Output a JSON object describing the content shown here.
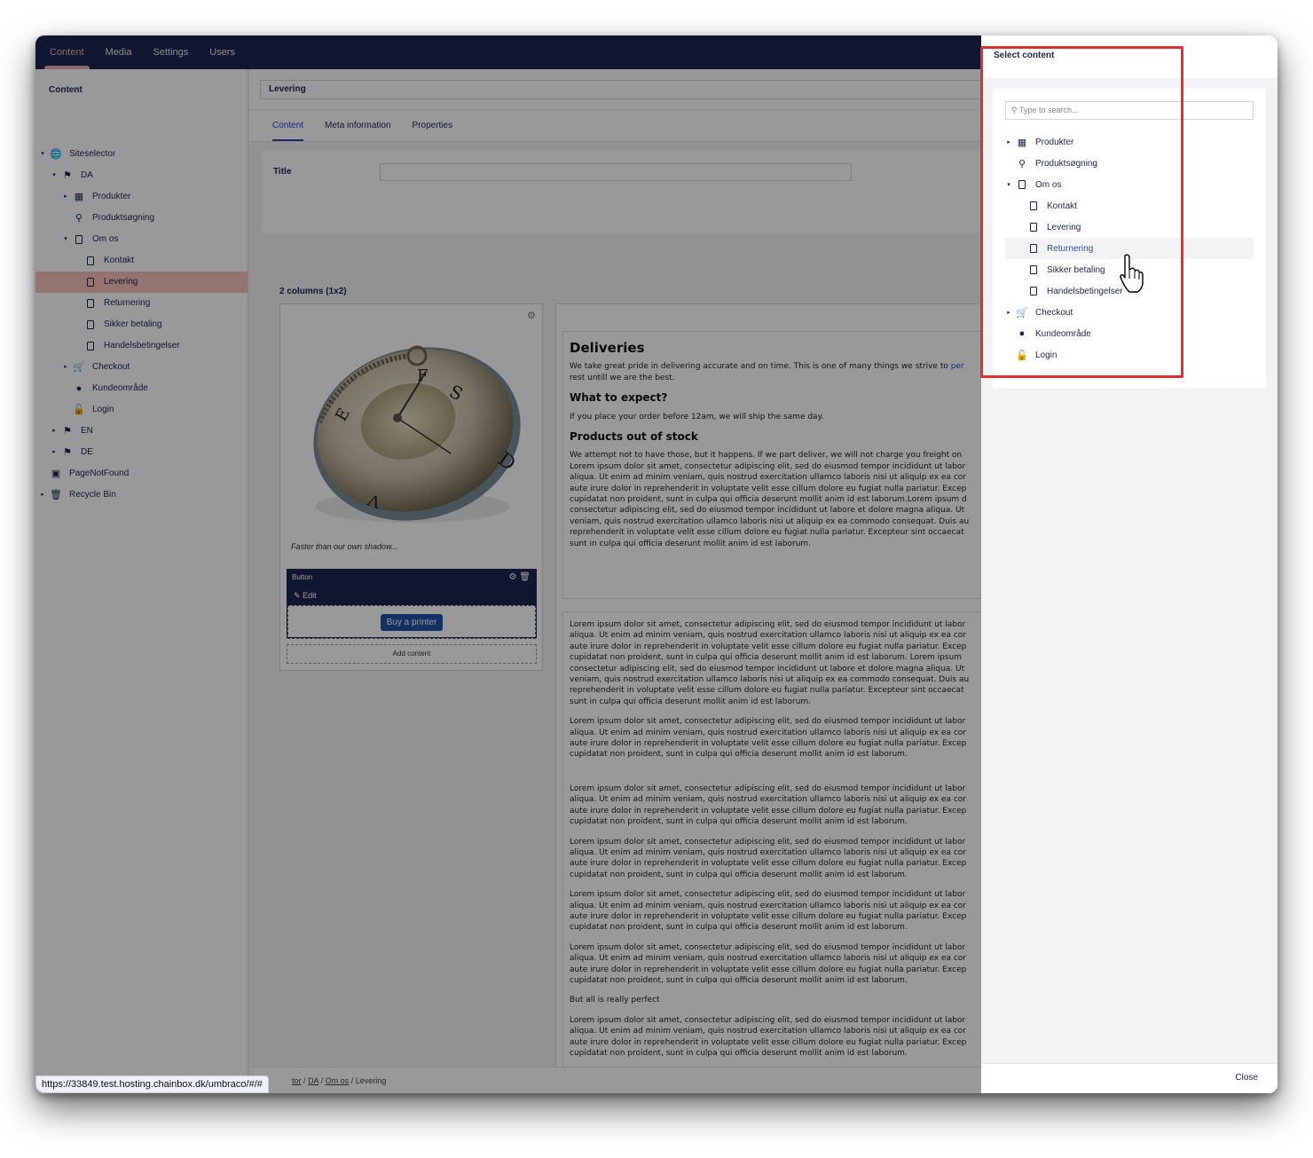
{
  "top_nav": {
    "items": [
      "Content",
      "Media",
      "Settings",
      "Users"
    ],
    "active": "Content"
  },
  "tree": {
    "header": "Content",
    "nodes": [
      {
        "label": "Siteselector",
        "icon": "globe-icon",
        "caret": "▾",
        "depth": 0,
        "selected": false
      },
      {
        "label": "DA",
        "icon": "flag-icon",
        "caret": "▾",
        "depth": 1,
        "selected": false
      },
      {
        "label": "Produkter",
        "icon": "grid-icon",
        "caret": "▸",
        "depth": 2,
        "selected": false
      },
      {
        "label": "Produktsøgning",
        "icon": "search-icon",
        "caret": "",
        "depth": 2,
        "selected": false
      },
      {
        "label": "Om os",
        "icon": "document-icon",
        "caret": "▾",
        "depth": 2,
        "selected": false
      },
      {
        "label": "Kontakt",
        "icon": "document-icon",
        "caret": "",
        "depth": 3,
        "selected": false
      },
      {
        "label": "Levering",
        "icon": "document-icon",
        "caret": "",
        "depth": 3,
        "selected": true
      },
      {
        "label": "Returnering",
        "icon": "document-icon",
        "caret": "",
        "depth": 3,
        "selected": false
      },
      {
        "label": "Sikker betaling",
        "icon": "document-icon",
        "caret": "",
        "depth": 3,
        "selected": false
      },
      {
        "label": "Handelsbetingelser",
        "icon": "document-icon",
        "caret": "",
        "depth": 3,
        "selected": false
      },
      {
        "label": "Checkout",
        "icon": "cart-icon",
        "caret": "▸",
        "depth": 2,
        "selected": false
      },
      {
        "label": "Kundeområde",
        "icon": "user-icon",
        "caret": "",
        "depth": 2,
        "selected": false
      },
      {
        "label": "Login",
        "icon": "unlock-icon",
        "caret": "",
        "depth": 2,
        "selected": false
      },
      {
        "label": "EN",
        "icon": "flag-icon",
        "caret": "▸",
        "depth": 1,
        "selected": false
      },
      {
        "label": "DE",
        "icon": "flag-icon",
        "caret": "▸",
        "depth": 1,
        "selected": false
      },
      {
        "label": "PageNotFound",
        "icon": "archive-icon",
        "caret": "",
        "depth": 0,
        "selected": false
      },
      {
        "label": "Recycle Bin",
        "icon": "trash-icon",
        "caret": "▸",
        "depth": 0,
        "selected": false
      }
    ]
  },
  "editor": {
    "node_name": "Levering",
    "tabs": [
      "Content",
      "Meta information",
      "Properties"
    ],
    "active_tab": "Content",
    "title_label": "Title",
    "title_value": "",
    "grid_header": "2 columns (1x2)",
    "image_caption": "Faster than our own shadow...",
    "button_block": {
      "title": "Button",
      "edit_label": "Edit",
      "button_text": "Buy a printer"
    },
    "add_content": "Add content",
    "rte1": {
      "h1": "Deliveries",
      "intro1": "We take great pride in delivering accurate and on time. This is one of many things we strive to ",
      "intro_link": "per",
      "intro2": "rest untill we are the best.",
      "h2a": "What to expect?",
      "p2": "If you place your order before 12am, we will ship the same day.",
      "h2b": "Products out of stock",
      "p3": [
        "We attempt not to have those, but it happens. If we part deliver, we will not charge you freight on",
        "Lorem ipsum dolor sit amet, consectetur adipiscing elit, sed do eiusmod tempor incididunt ut labor",
        "aliqua. Ut enim ad minim veniam, quis nostrud exercitation ullamco laboris nisi ut aliquip ex ea cor",
        "aute irure dolor in reprehenderit in voluptate velit esse cillum dolore eu fugiat nulla pariatur. Excep",
        "cupidatat non proident, sunt in culpa qui officia deserunt mollit anim id est laborum.Lorem ipsum d",
        "consectetur adipiscing elit, sed do eiusmod tempor incididunt ut labore et dolore magna aliqua. Ut",
        "veniam, quis nostrud exercitation ullamco laboris nisi ut aliquip ex ea commodo consequat. Duis au",
        "reprehenderit in voluptate velit esse cillum dolore eu fugiat nulla pariatur. Excepteur sint occaecat",
        "sunt in culpa qui officia deserunt mollit anim id est laborum."
      ]
    },
    "rte2": {
      "p1": [
        "Lorem ipsum dolor sit amet, consectetur adipiscing elit, sed do eiusmod tempor incididunt ut labor",
        "aliqua. Ut enim ad minim veniam, quis nostrud exercitation ullamco laboris nisi ut aliquip ex ea cor",
        "aute irure dolor in reprehenderit in voluptate velit esse cillum dolore eu fugiat nulla pariatur. Excep",
        "cupidatat non proident, sunt in culpa qui officia deserunt mollit anim id est laborum. Lorem ipsum",
        "consectetur adipiscing elit, sed do eiusmod tempor incididunt ut labore et dolore magna aliqua. Ut",
        "veniam, quis nostrud exercitation ullamco laboris nisi ut aliquip ex ea commodo consequat. Duis au",
        "reprehenderit in voluptate velit esse cillum dolore eu fugiat nulla pariatur. Excepteur sint occaecat",
        "sunt in culpa qui officia deserunt mollit anim id est laborum."
      ],
      "lorem4": [
        "Lorem ipsum dolor sit amet, consectetur adipiscing elit, sed do eiusmod tempor incididunt ut labor",
        "aliqua. Ut enim ad minim veniam, quis nostrud exercitation ullamco laboris nisi ut aliquip ex ea cor",
        "aute irure dolor in reprehenderit in voluptate velit esse cillum dolore eu fugiat nulla pariatur. Excep",
        "cupidatat non proident, sunt in culpa qui officia deserunt mollit anim id est laborum."
      ],
      "perfect": "But all is really perfect"
    },
    "breadcrumbs": {
      "first": "tor",
      "sep": "/",
      "items": [
        "DA",
        "Om os"
      ],
      "current": "Levering"
    }
  },
  "picker": {
    "title": "Select content",
    "search_placeholder": "Type to search...",
    "nodes": [
      {
        "label": "Produkter",
        "icon": "grid-icon",
        "caret": "▸",
        "depth": 0,
        "hover": false
      },
      {
        "label": "Produktsøgning",
        "icon": "search-icon",
        "caret": "",
        "depth": 0,
        "hover": false
      },
      {
        "label": "Om os",
        "icon": "document-icon",
        "caret": "▾",
        "depth": 0,
        "hover": false
      },
      {
        "label": "Kontakt",
        "icon": "document-icon",
        "caret": "",
        "depth": 1,
        "hover": false
      },
      {
        "label": "Levering",
        "icon": "document-icon",
        "caret": "",
        "depth": 1,
        "hover": false
      },
      {
        "label": "Returnering",
        "icon": "document-icon",
        "caret": "",
        "depth": 1,
        "hover": true
      },
      {
        "label": "Sikker betaling",
        "icon": "document-icon",
        "caret": "",
        "depth": 1,
        "hover": false
      },
      {
        "label": "Handelsbetingelser",
        "icon": "document-icon",
        "caret": "",
        "depth": 1,
        "hover": false
      },
      {
        "label": "Checkout",
        "icon": "cart-icon",
        "caret": "▸",
        "depth": 0,
        "hover": false
      },
      {
        "label": "Kundeområde",
        "icon": "user-icon",
        "caret": "",
        "depth": 0,
        "hover": false
      },
      {
        "label": "Login",
        "icon": "unlock-icon",
        "caret": "",
        "depth": 0,
        "hover": false
      }
    ],
    "close_label": "Close"
  },
  "status_url": "https://33849.test.hosting.chainbox.dk/umbraco/#/#",
  "colors": {
    "header": "#1b264f",
    "selected": "#f5c1bc",
    "highlight_box": "#e03131",
    "button": "#2152a3"
  }
}
